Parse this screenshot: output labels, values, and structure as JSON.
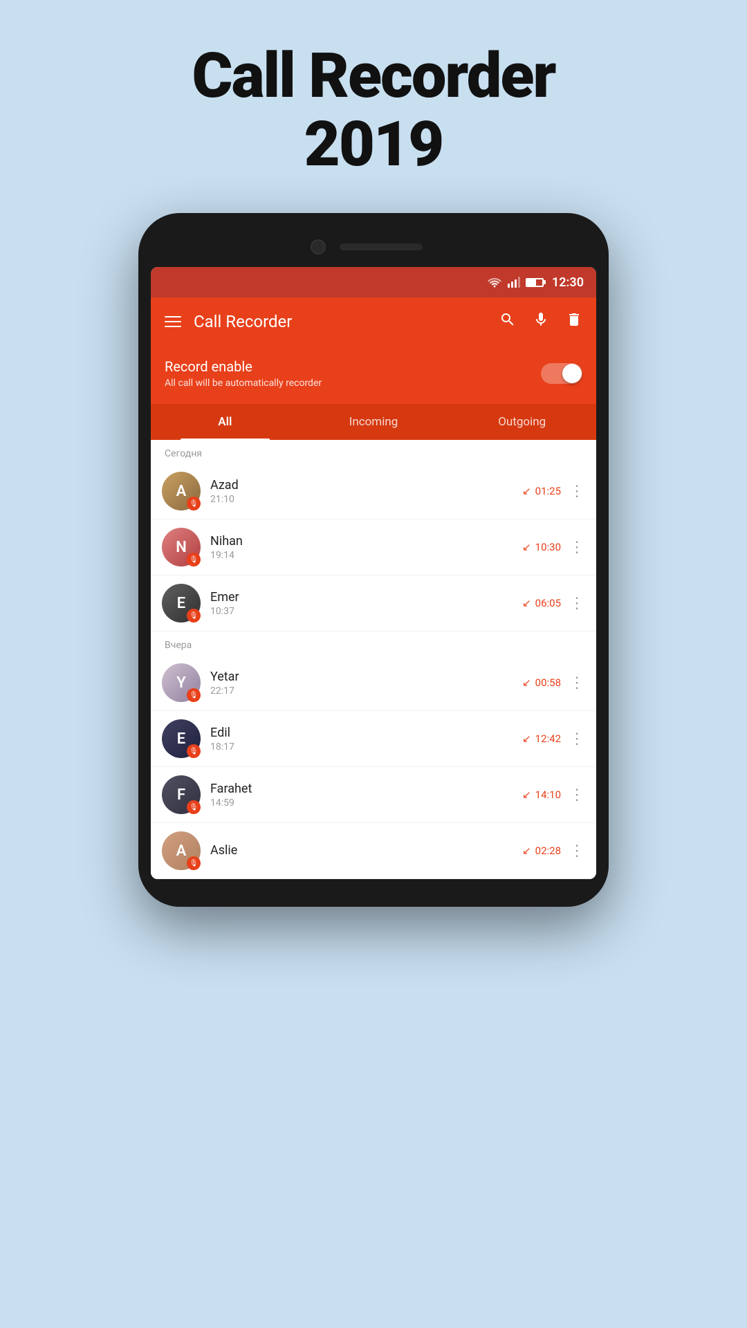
{
  "app_title_line1": "Call Recorder",
  "app_title_line2": "2019",
  "status_bar": {
    "time": "12:30"
  },
  "app_bar": {
    "title": "Call Recorder",
    "search_label": "Search",
    "mic_label": "Microphone",
    "delete_label": "Delete"
  },
  "record_section": {
    "title": "Record enable",
    "subtitle": "All call will be automatically recorder",
    "toggle_on": true
  },
  "tabs": [
    {
      "label": "All",
      "active": true
    },
    {
      "label": "Incoming",
      "active": false
    },
    {
      "label": "Outgoing",
      "active": false
    }
  ],
  "sections": [
    {
      "header": "Сегодня",
      "calls": [
        {
          "name": "Azad",
          "time": "21:10",
          "duration": "01:25",
          "avatar_class": "av-azad",
          "initials": "A"
        },
        {
          "name": "Nihan",
          "time": "19:14",
          "duration": "10:30",
          "avatar_class": "av-nihan",
          "initials": "N"
        },
        {
          "name": "Emer",
          "time": "10:37",
          "duration": "06:05",
          "avatar_class": "av-emer",
          "initials": "E"
        }
      ]
    },
    {
      "header": "Вчера",
      "calls": [
        {
          "name": "Yetar",
          "time": "22:17",
          "duration": "00:58",
          "avatar_class": "av-yetar",
          "initials": "Y"
        },
        {
          "name": "Edil",
          "time": "18:17",
          "duration": "12:42",
          "avatar_class": "av-edil",
          "initials": "E"
        },
        {
          "name": "Farahet",
          "time": "14:59",
          "duration": "14:10",
          "avatar_class": "av-farahet",
          "initials": "F"
        },
        {
          "name": "Aslie",
          "time": "...",
          "duration": "02:28",
          "avatar_class": "av-aslie",
          "initials": "A"
        }
      ]
    }
  ]
}
